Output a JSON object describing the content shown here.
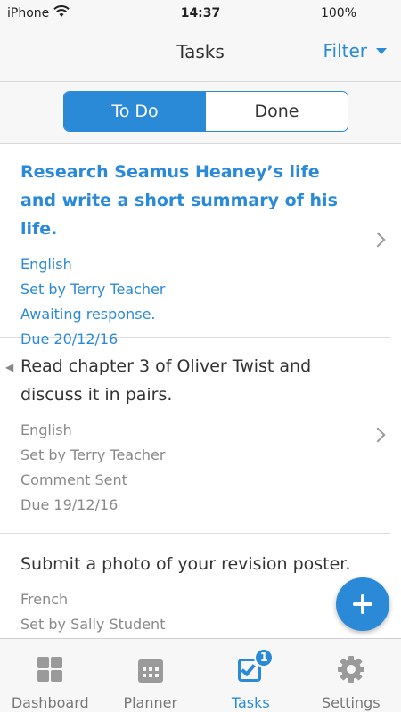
{
  "status_bar": {
    "carrier": "iPhone",
    "time": "14:37",
    "battery": "100%"
  },
  "nav": {
    "title": "Tasks",
    "filter_label": "Filter"
  },
  "segments": {
    "todo": "To Do",
    "done": "Done",
    "selected": "To Do"
  },
  "tasks": [
    {
      "title": "Research Seamus Heaney’s life and write a short summary of his life.",
      "subject": "English",
      "set_by": "Set by Terry Teacher",
      "status": "Awaiting response.",
      "due": "Due 20/12/16"
    },
    {
      "title": "Read chapter 3 of Oliver Twist and discuss it in pairs.",
      "subject": "English",
      "set_by": "Set by Terry Teacher",
      "status": "Comment Sent",
      "due": "Due 19/12/16"
    },
    {
      "title": "Submit a photo of your revision poster.",
      "subject": "French",
      "set_by": "Set by Sally Student",
      "status": "",
      "due": ""
    }
  ],
  "tab_bar": {
    "dashboard": "Dashboard",
    "planner": "Planner",
    "tasks": "Tasks",
    "settings": "Settings",
    "tasks_badge": "1",
    "active": "Tasks"
  },
  "colors": {
    "accent": "#2a8ad8",
    "muted_text": "#888888",
    "bar_background": "#f7f7f7"
  }
}
